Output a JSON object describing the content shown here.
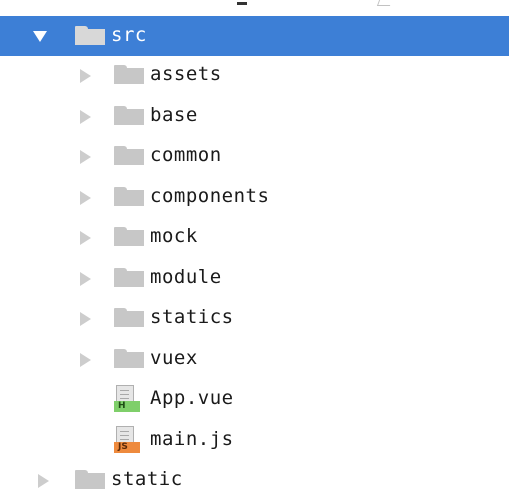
{
  "tree": {
    "src": {
      "label": "src"
    },
    "children": [
      {
        "label": "assets"
      },
      {
        "label": "base"
      },
      {
        "label": "common"
      },
      {
        "label": "components"
      },
      {
        "label": "mock"
      },
      {
        "label": "module"
      },
      {
        "label": "statics"
      },
      {
        "label": "vuex"
      }
    ],
    "files": [
      {
        "label": "App.vue",
        "badge": "H",
        "badge_color": "#7fcf6a"
      },
      {
        "label": "main.js",
        "badge": "JS",
        "badge_color": "#ee8a3d"
      }
    ],
    "static": {
      "label": "static"
    }
  },
  "colors": {
    "selection": "#3d7fd6",
    "folder": "#c7c7c7",
    "arrow": "#cdcdcd"
  },
  "icons": {
    "expanded": "chevron-down-icon",
    "collapsed": "chevron-right-icon",
    "folder": "folder-icon",
    "vue_file": "vue-file-icon",
    "js_file": "js-file-icon"
  }
}
